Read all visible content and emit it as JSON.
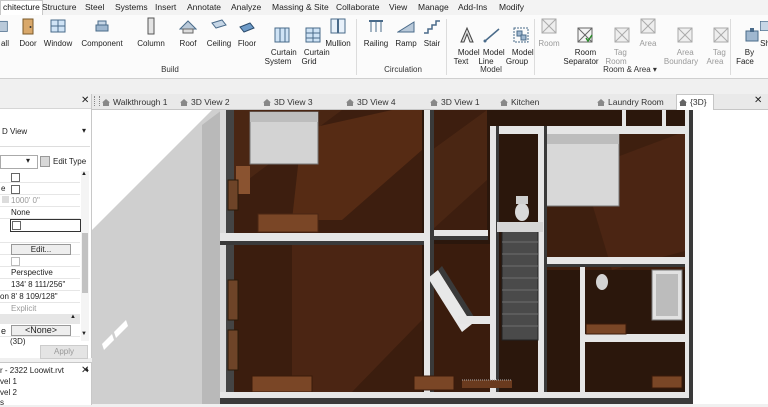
{
  "ribbon_tabs": [
    "chitecture",
    "Structure",
    "Steel",
    "Systems",
    "Insert",
    "Annotate",
    "Analyze",
    "Massing & Site",
    "Collaborate",
    "View",
    "Manage",
    "Add-Ins",
    "Modify"
  ],
  "build": {
    "buttons": [
      {
        "label": "all",
        "icon": "wall-icon"
      },
      {
        "label": "Door",
        "icon": "door-icon"
      },
      {
        "label": "Window",
        "icon": "window-icon"
      },
      {
        "label": "Component",
        "icon": "component-icon"
      },
      {
        "label": "Column",
        "icon": "column-icon"
      },
      {
        "label": "Roof",
        "icon": "roof-icon"
      },
      {
        "label": "Ceiling",
        "icon": "ceiling-icon"
      },
      {
        "label": "Floor",
        "icon": "floor-icon"
      },
      {
        "label": "Curtain\nSystem",
        "icon": "curtain-system-icon"
      },
      {
        "label": "Curtain\nGrid",
        "icon": "curtain-grid-icon"
      },
      {
        "label": "Mullion",
        "icon": "mullion-icon"
      }
    ],
    "group_label": "Build"
  },
  "circulation": {
    "buttons": [
      {
        "label": "Railing",
        "icon": "railing-icon"
      },
      {
        "label": "Ramp",
        "icon": "ramp-icon"
      },
      {
        "label": "Stair",
        "icon": "stair-icon"
      }
    ],
    "group_label": "Circulation"
  },
  "model": {
    "buttons": [
      {
        "label": "Model\nText",
        "icon": "model-text-icon"
      },
      {
        "label": "Model\nLine",
        "icon": "model-line-icon"
      },
      {
        "label": "Model\nGroup",
        "icon": "model-group-icon"
      }
    ],
    "group_label": "Model"
  },
  "room_area": {
    "buttons": [
      {
        "label": "Room",
        "icon": "room-icon",
        "disabled": true
      },
      {
        "label": "Room\nSeparator",
        "icon": "room-separator-icon",
        "disabled": false
      },
      {
        "label": "Tag\nRoom",
        "icon": "tag-room-icon",
        "disabled": true
      },
      {
        "label": "Area",
        "icon": "area-icon",
        "disabled": true
      },
      {
        "label": "Area\nBoundary",
        "icon": "area-boundary-icon",
        "disabled": true
      },
      {
        "label": "Tag\nArea",
        "icon": "tag-area-icon",
        "disabled": true
      },
      {
        "label": "By\nFace",
        "icon": "by-face-icon",
        "disabled": false
      },
      {
        "label": "Sh",
        "icon": "shaft-icon",
        "disabled": false
      }
    ],
    "group_label": "Room & Area"
  },
  "properties": {
    "type_label": "D View",
    "edit_type": "Edit Type",
    "rows": [
      {
        "label": "",
        "value": "",
        "check": true
      },
      {
        "label": "e",
        "value": "",
        "check": true
      },
      {
        "label": "",
        "value": "1000' 0\"",
        "check": false,
        "muted": true
      },
      {
        "label": "",
        "value": "None",
        "check": false
      },
      {
        "label": "",
        "value": "",
        "check": true
      },
      {
        "label": "",
        "value": "Edit...",
        "check": false,
        "button": true
      },
      {
        "label": "",
        "value": "",
        "check": true
      },
      {
        "label": "",
        "value": "Perspective",
        "check": false
      },
      {
        "label": "",
        "value": "134'  8 111/256\"",
        "check": false
      },
      {
        "label": "on",
        "value": "8'  8 109/128\"",
        "check": false
      },
      {
        "label": "",
        "value": "Explicit",
        "check": false,
        "muted": true
      }
    ],
    "phase_label": "e",
    "phase_value": "<None>",
    "extra_value": "(3D)",
    "apply": "Apply"
  },
  "browser": {
    "title": "r - 2322 Loowit.rvt",
    "items": [
      "vel 1",
      "vel 2",
      "s"
    ]
  },
  "view_tabs": [
    "Walkthrough 1",
    "3D View 2",
    "3D View 3",
    "3D View 4",
    "3D View 1",
    "Kitchen",
    "Laundry Room",
    "{3D}"
  ],
  "colors": {
    "floor": "#3a1c0e",
    "wall_top": "#e6e6e6",
    "wall_dark": "#3c3c3c"
  }
}
